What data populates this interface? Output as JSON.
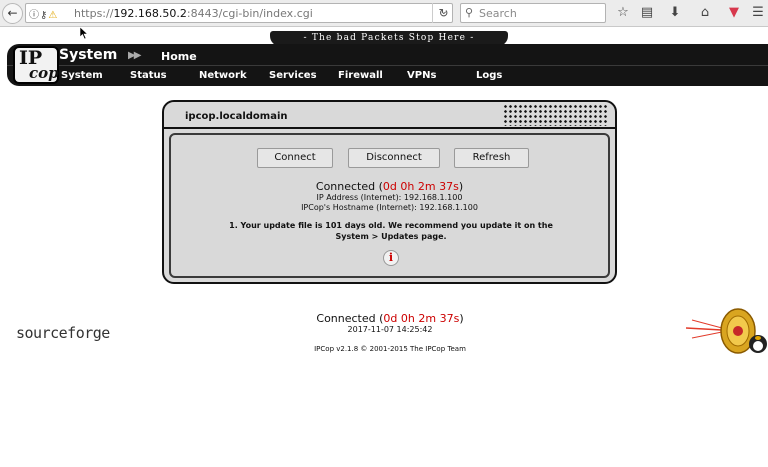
{
  "browser": {
    "url_scheme": "https://",
    "url_host": "192.168.50.2",
    "url_rest": ":8443/cgi-bin/index.cgi",
    "search_placeholder": "Search"
  },
  "header": {
    "tagline": "- The bad Packets Stop Here -",
    "logo_ip": "IP",
    "logo_cop": "cop",
    "section": "System",
    "current_page": "Home"
  },
  "menu": {
    "items": [
      "System",
      "Status",
      "Network",
      "Services",
      "Firewall",
      "VPNs",
      "Logs"
    ]
  },
  "panel": {
    "title": "ipcop.localdomain",
    "buttons": {
      "connect": "Connect",
      "disconnect": "Disconnect",
      "refresh": "Refresh"
    },
    "status_prefix": "Connected (",
    "uptime": "0d 0h 2m 37s",
    "status_suffix": ")",
    "ip_address": "IP Address (Internet): 192.168.1.100",
    "hostname": "IPCop's Hostname (Internet): 192.168.1.100",
    "notice": "1. Your update file is 101 days old. We recommend you update it on the System > Updates page.",
    "info_glyph": "i"
  },
  "footer": {
    "sourceforge": "sourceforge",
    "status_prefix": "Connected (",
    "uptime": "0d 0h 2m 37s",
    "status_suffix": ")",
    "datetime": "2017-11-07 14:25:42",
    "copyright": "IPCop v2.1.8 © 2001-2015 The IPCop Team"
  },
  "colors": {
    "uptime": "#cc0000",
    "header_bg": "#141414",
    "panel_bg": "#d9d9d9"
  }
}
